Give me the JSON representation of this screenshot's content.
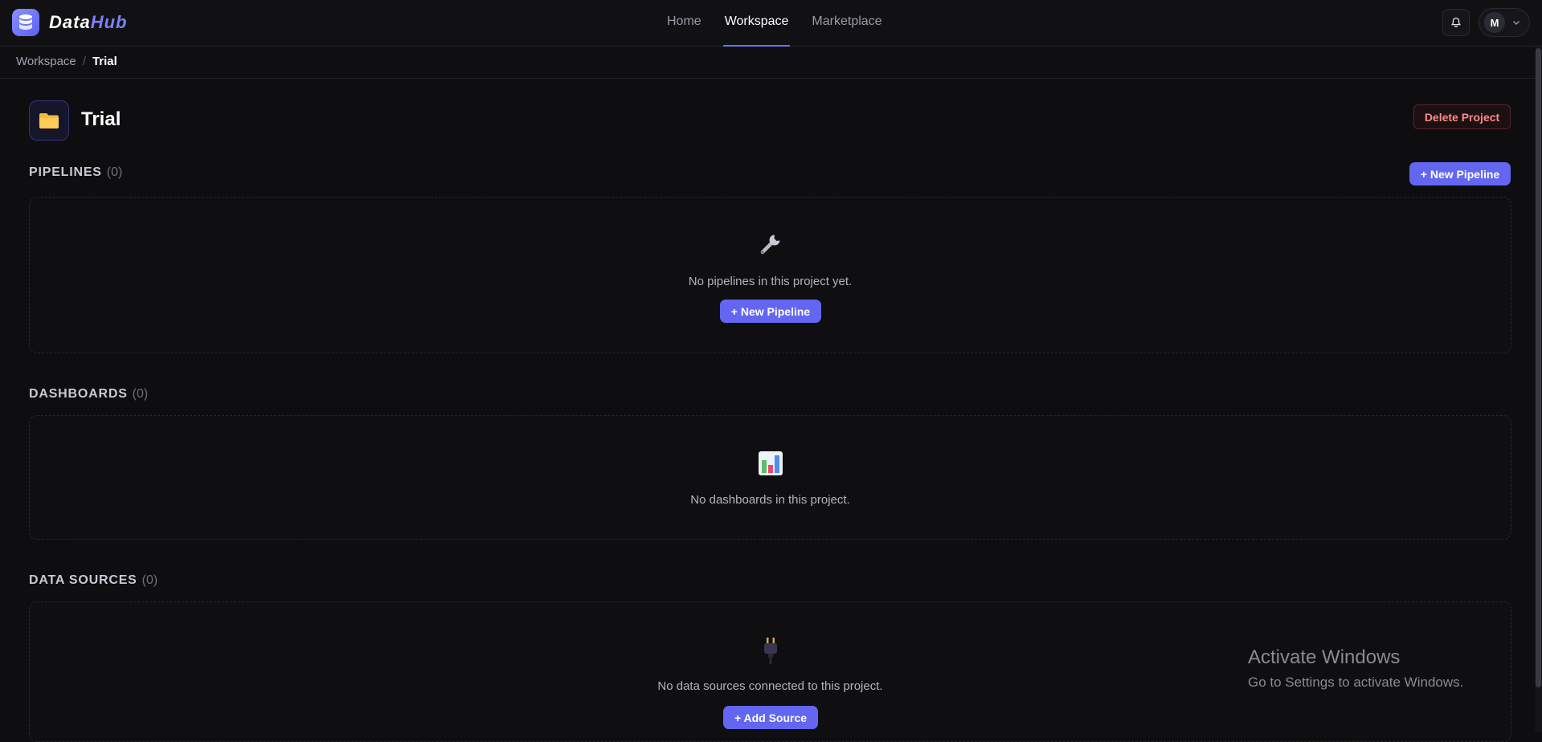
{
  "app": {
    "logo_name": "DataHub",
    "logo_word_1": "Data",
    "logo_word_2": "Hub"
  },
  "nav": {
    "items": [
      {
        "label": "Home",
        "active": false
      },
      {
        "label": "Workspace",
        "active": true
      },
      {
        "label": "Marketplace",
        "active": false
      }
    ]
  },
  "user": {
    "initial": "M"
  },
  "breadcrumb": {
    "items": [
      "Workspace"
    ],
    "current": "Trial",
    "separator": "/"
  },
  "project": {
    "title": "Trial",
    "icon": "folder-icon",
    "delete_label": "Delete Project"
  },
  "sections": {
    "pipelines": {
      "title": "PIPELINES",
      "count": "(0)",
      "header_button": "+ New Pipeline",
      "empty_icon": "wrench-icon",
      "empty_text": "No pipelines in this project yet.",
      "empty_button": "+ New Pipeline"
    },
    "dashboards": {
      "title": "DASHBOARDS",
      "count": "(0)",
      "empty_icon": "bar-chart-icon",
      "empty_text": "No dashboards in this project."
    },
    "data_sources": {
      "title": "DATA SOURCES",
      "count": "(0)",
      "empty_icon": "plug-icon",
      "empty_text": "No data sources connected to this project.",
      "empty_button": "+ Add Source"
    }
  },
  "watermark": {
    "title": "Activate Windows",
    "subtitle": "Go to Settings to activate Windows."
  },
  "colors": {
    "background": "#0e0e11",
    "accent": "#6366f1",
    "danger": "#ff8a8a"
  }
}
